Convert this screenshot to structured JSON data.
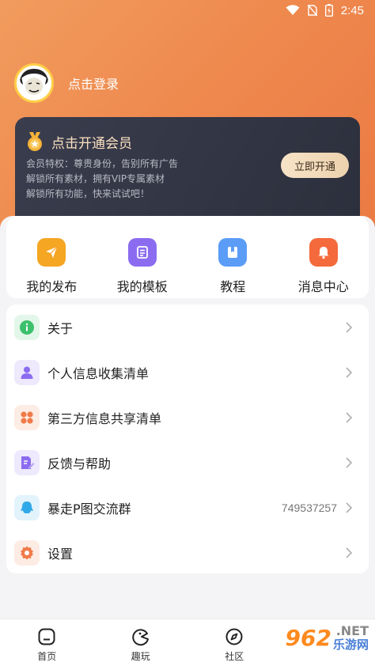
{
  "status_bar": {
    "time": "2:45"
  },
  "profile": {
    "login_text": "点击登录"
  },
  "vip": {
    "title": "点击开通会员",
    "desc_line1": "会员特权：尊贵身份，告别所有广告",
    "desc_line2": "解锁所有素材，拥有VIP专属素材",
    "desc_line3": "解锁所有功能，快来试试吧！",
    "button_label": "立即开通"
  },
  "quick_actions": [
    {
      "label": "我的发布",
      "icon": "send-icon",
      "color": "#f5a623"
    },
    {
      "label": "我的模板",
      "icon": "template-icon",
      "color": "#8b6cf0"
    },
    {
      "label": "教程",
      "icon": "book-icon",
      "color": "#5b9cf7"
    },
    {
      "label": "消息中心",
      "icon": "bell-icon",
      "color": "#f46a3c"
    }
  ],
  "menu": [
    {
      "label": "关于",
      "icon": "info-icon",
      "color": "#3cc06c"
    },
    {
      "label": "个人信息收集清单",
      "icon": "person-icon",
      "color": "#8b6cf0"
    },
    {
      "label": "第三方信息共享清单",
      "icon": "grid-icon",
      "color": "#f07a4a"
    },
    {
      "label": "反馈与帮助",
      "icon": "edit-doc-icon",
      "color": "#8b6cf0"
    },
    {
      "label": "暴走P图交流群",
      "icon": "qq-icon",
      "color": "#2fa9e8",
      "value": "749537257"
    },
    {
      "label": "设置",
      "icon": "gear-icon",
      "color": "#f07a4a"
    }
  ],
  "tabbar": [
    {
      "label": "首页",
      "icon": "home-icon"
    },
    {
      "label": "趣玩",
      "icon": "fun-icon"
    },
    {
      "label": "社区",
      "icon": "compass-icon"
    }
  ],
  "watermark": {
    "number": "962",
    "suffix": ".NET",
    "text": "乐游网"
  }
}
